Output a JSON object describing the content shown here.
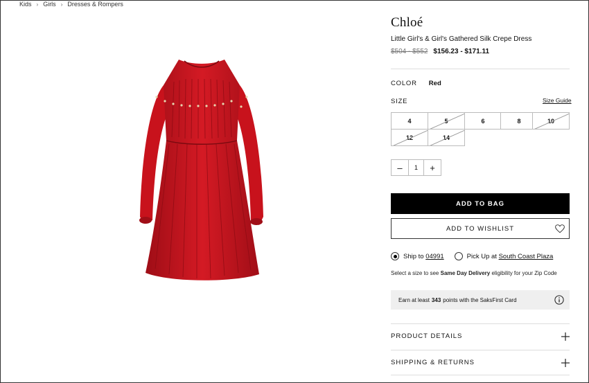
{
  "breadcrumb": {
    "items": [
      "Kids",
      "Girls",
      "Dresses & Rompers"
    ],
    "separator": "›"
  },
  "product": {
    "brand": "Chloé",
    "title": "Little Girl's & Girl's Gathered Silk Crepe Dress",
    "original_price": "$504 - $552",
    "sale_price": "$156.23  - $171.11",
    "dress_color": "#c8121c"
  },
  "color": {
    "label": "COLOR",
    "value": "Red"
  },
  "size": {
    "label": "SIZE",
    "guide_label": "Size Guide",
    "options": [
      {
        "label": "4",
        "available": true
      },
      {
        "label": "5",
        "available": false
      },
      {
        "label": "6",
        "available": true
      },
      {
        "label": "8",
        "available": true
      },
      {
        "label": "10",
        "available": false
      },
      {
        "label": "12",
        "available": false
      },
      {
        "label": "14",
        "available": false
      }
    ]
  },
  "quantity": {
    "value": "1",
    "minus": "–",
    "plus": "+"
  },
  "buttons": {
    "add_to_bag": "ADD TO BAG",
    "add_to_wishlist": "ADD TO WISHLIST"
  },
  "shipping": {
    "ship_to_label": "Ship to",
    "zip": "04991",
    "pickup_label": "Pick Up at",
    "store": "South Coast Plaza",
    "selected": "ship"
  },
  "note": {
    "prefix": "Select a size to see",
    "bold": "Same Day Delivery",
    "suffix": "eligibility for your Zip Code"
  },
  "points": {
    "prefix": "Earn at least",
    "value": "343",
    "suffix": "points with the SaksFirst Card"
  },
  "accordions": [
    "PRODUCT DETAILS",
    "SHIPPING & RETURNS"
  ],
  "icons": [
    "chevron-right-icon",
    "heart-icon",
    "info-icon",
    "plus-icon",
    "minus-icon"
  ]
}
